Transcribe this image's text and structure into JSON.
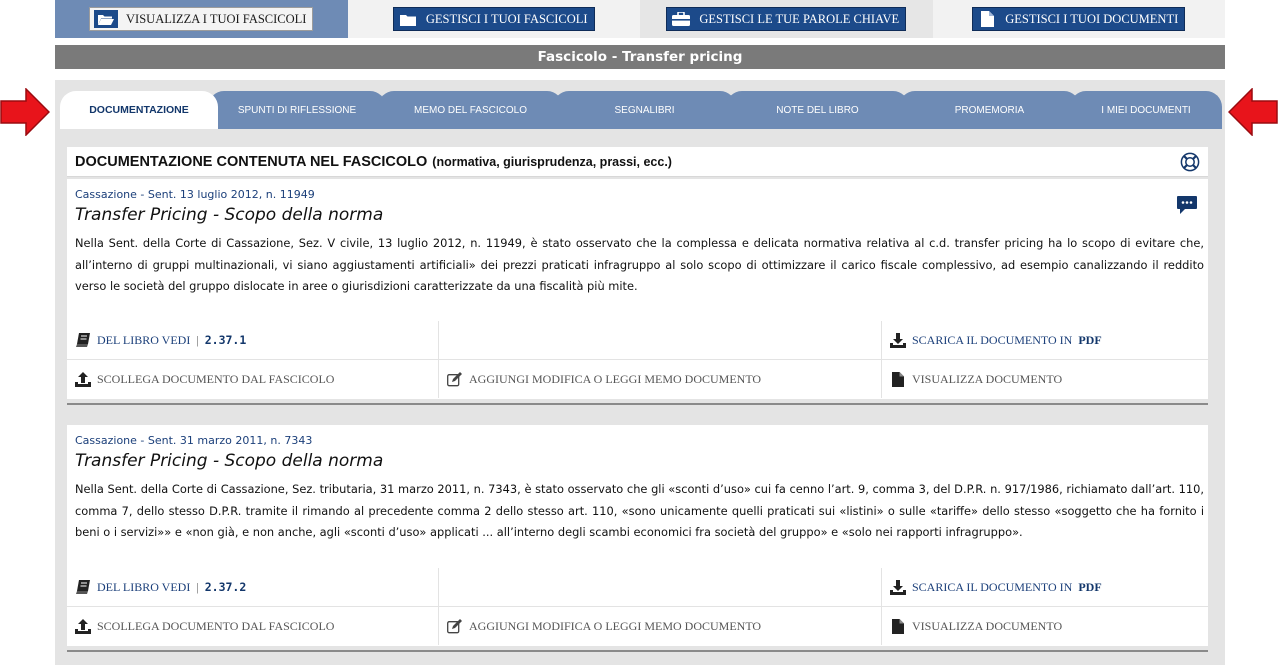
{
  "top_tabs": [
    {
      "label": "VISUALIZZA I TUOI FASCICOLI",
      "icon": "folder-open-icon"
    },
    {
      "label": "GESTISCI I TUOI FASCICOLI",
      "icon": "folder-icon"
    },
    {
      "label": "GESTISCI LE TUE PAROLE CHIAVE",
      "icon": "briefcase-icon"
    },
    {
      "label": "GESTISCI I TUOI DOCUMENTI",
      "icon": "document-icon"
    }
  ],
  "page_title": "Fascicolo - Transfer pricing",
  "section_tabs": [
    "DOCUMENTAZIONE",
    "SPUNTI DI RIFLESSIONE",
    "MEMO DEL FASCICOLO",
    "SEGNALIBRI",
    "NOTE DEL LIBRO",
    "PROMEMORIA",
    "I MIEI DOCUMENTI"
  ],
  "header": {
    "main": "DOCUMENTAZIONE CONTENUTA NEL FASCICOLO",
    "sub": "(normativa, giurisprudenza, prassi, ecc.)"
  },
  "actions": {
    "book_prefix": "DEL LIBRO VEDI",
    "separator": "|",
    "download": "SCARICA IL DOCUMENTO IN",
    "download_format": "PDF",
    "unlink": "SCOLLEGA DOCUMENTO DAL FASCICOLO",
    "memo": "AGGIUNGI MODIFICA O LEGGI MEMO DOCUMENTO",
    "view": "VISUALIZZA DOCUMENTO"
  },
  "documents": [
    {
      "ref": "Cassazione - Sent. 13 luglio 2012, n. 11949",
      "title": "Transfer Pricing - Scopo della norma",
      "body": "Nella Sent. della Corte di Cassazione, Sez. V civile, 13 luglio 2012, n. 11949, è stato osservato che la complessa e delicata normativa relativa al c.d. transfer pricing ha lo scopo di evitare che, all’interno di gruppi multinazionali, vi siano aggiustamenti artificiali» dei prezzi praticati infragruppo al solo scopo di ottimizzare il carico fiscale complessivo, ad esempio canalizzando il reddito verso le società del gruppo dislocate in aree o giurisdizioni caratterizzate da una fiscalità più mite.",
      "book_ref": "2.37.1"
    },
    {
      "ref": "Cassazione - Sent. 31 marzo 2011, n. 7343",
      "title": "Transfer Pricing - Scopo della norma",
      "body": "Nella Sent. della Corte di Cassazione, Sez. tributaria, 31 marzo 2011, n. 7343, è stato osservato che gli «sconti d’uso» cui fa cenno l’art. 9, comma 3, del D.P.R. n. 917/1986, richiamato dall’art. 110, comma 7, dello stesso D.P.R. tramite il rimando al precedente comma 2 dello stesso art. 110, «sono unicamente quelli praticati sui «listini» o sulle «tariffe» dello stesso «soggetto che ha fornito i beni o i servizi»» e «non già, e non anche, agli «sconti d’uso» applicati ... all’interno degli scambi economici fra società del gruppo» e «solo nei rapporti infragruppo».",
      "book_ref": "2.37.2"
    }
  ],
  "colors": {
    "tab_blue": "#6e8bb5",
    "title_grey": "#7a7a7a",
    "panel_grey": "#e4e4e4",
    "arrow_red": "#e8141b",
    "link_blue": "#1b3f7a"
  }
}
